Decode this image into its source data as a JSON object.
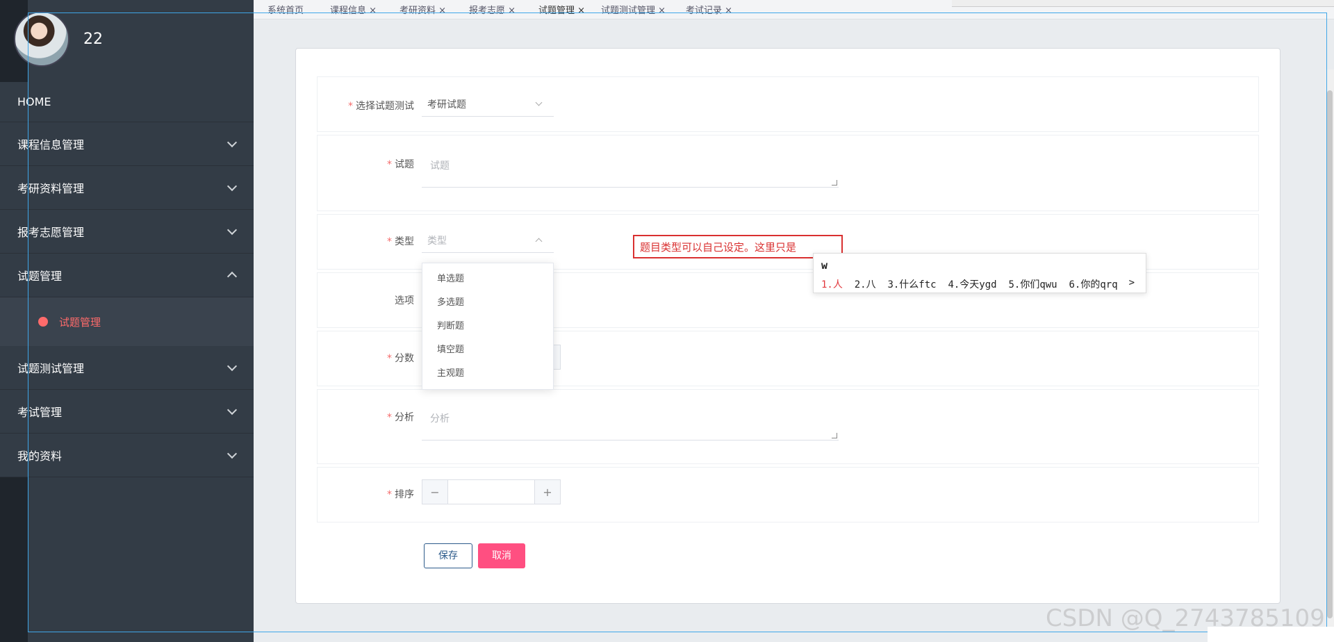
{
  "sidebar": {
    "username": "22",
    "items": [
      {
        "label": "HOME"
      },
      {
        "label": "课程信息管理"
      },
      {
        "label": "考研资料管理"
      },
      {
        "label": "报考志愿管理"
      },
      {
        "label": "试题管理"
      },
      {
        "label": "试题测试管理"
      },
      {
        "label": "考试管理"
      },
      {
        "label": "我的资料"
      }
    ],
    "sub_item": "试题管理"
  },
  "tabs": [
    "系统首页",
    "课程信息",
    "考研资料",
    "报考志愿",
    "试题管理",
    "试题测试管理",
    "考试记录"
  ],
  "form": {
    "test_label": "选择试题测试",
    "test_value": "考研试题",
    "question_label": "试题",
    "question_placeholder": "试题",
    "type_label": "类型",
    "type_placeholder": "类型",
    "options_label": "选项",
    "score_label": "分数",
    "analysis_label": "分析",
    "analysis_placeholder": "分析",
    "order_label": "排序",
    "minus": "−",
    "plus": "+",
    "save": "保存",
    "cancel": "取消"
  },
  "type_options": [
    "单选题",
    "多选题",
    "判断题",
    "填空题",
    "主观题"
  ],
  "annotation": "题目类型可以自己设定。这里只是",
  "ime": {
    "composition": "w",
    "candidates": [
      "1.人",
      "2.八",
      "3.什么ftc",
      "4.今天ygd",
      "5.你们qwu",
      "6.你的qrq"
    ],
    "next": ">"
  },
  "watermark": "CSDN @Q_2743785109",
  "colors": {
    "accent": "#ff6b6b",
    "cancel": "#ff4f81",
    "annotation": "#d93030"
  }
}
